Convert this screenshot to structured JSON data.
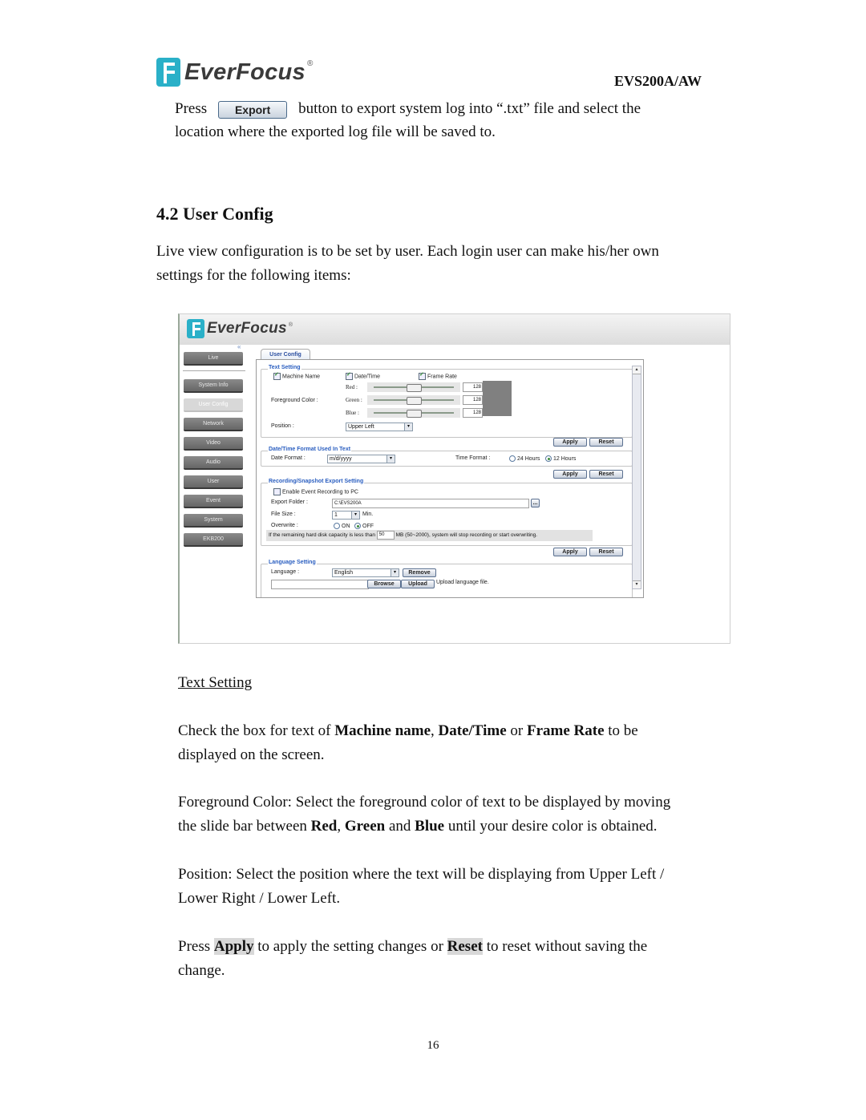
{
  "header": {
    "brand": "EverFocus",
    "brand_mark": "®",
    "model": "EVS200A/AW"
  },
  "intro": {
    "press": "Press",
    "export_button": "Export",
    "line1_rest": "button to export system log into “.txt” file and select the",
    "line2": "location where the exported log file will be saved to."
  },
  "section": {
    "title": "4.2 User Config",
    "desc_line1": "Live view configuration is to be set by user. Each login user can make his/her own",
    "desc_line2": "settings for the following items:"
  },
  "screenshot": {
    "brand": "EverFocus",
    "brand_mark": "®",
    "collapse_icon": "«",
    "nav": [
      {
        "label": "Live",
        "active": false
      },
      {
        "label": "System Info",
        "active": false
      },
      {
        "label": "User Config",
        "active": true
      },
      {
        "label": "Network",
        "active": false
      },
      {
        "label": "Video",
        "active": false
      },
      {
        "label": "Audio",
        "active": false
      },
      {
        "label": "User",
        "active": false
      },
      {
        "label": "Event",
        "active": false
      },
      {
        "label": "System",
        "active": false
      },
      {
        "label": "EKB200",
        "active": false
      }
    ],
    "tab": "User Config",
    "text_setting": {
      "legend": "Text Setting",
      "machine_name": "Machine Name",
      "machine_name_checked": true,
      "date_time": "Date/Time",
      "date_time_checked": true,
      "frame_rate": "Frame Rate",
      "frame_rate_checked": true,
      "foreground_label": "Foreground Color :",
      "red_label": "Red :",
      "green_label": "Green :",
      "blue_label": "Blue :",
      "red_value": "128",
      "green_value": "128",
      "blue_value": "128",
      "swatch_color": "#808080",
      "position_label": "Position :",
      "position_value": "Upper Left"
    },
    "date_time_format": {
      "legend": "Date/Time Format Used In Text",
      "date_format_label": "Date Format :",
      "date_format_value": "m/d/yyyy",
      "time_format_label": "Time Format :",
      "opt_24": "24 Hours",
      "opt_12": "12 Hours",
      "selected": "12 Hours"
    },
    "recording": {
      "legend": "Recording/Snapshot Export Setting",
      "enable_label": "Enable Event Recording to PC",
      "enable_checked": false,
      "export_folder_label": "Export Folder :",
      "export_folder_value": "C:\\EVS200A",
      "browse_icon": "...",
      "file_size_label": "File Size :",
      "file_size_value": "1",
      "file_size_unit": "Min.",
      "overwrite_label": "Overwrite :",
      "opt_on": "ON",
      "opt_off": "OFF",
      "overwrite_selected": "OFF",
      "warn_pre": "If the remaining hard disk capacity is less than",
      "warn_value": "50",
      "warn_post": "MB (50~2000), system will stop recording or start overwriting."
    },
    "language": {
      "legend": "Language Setting",
      "language_label": "Language :",
      "language_value": "English",
      "remove": "Remove",
      "browse": "Browse",
      "upload": "Upload",
      "upload_hint": "Upload language file."
    },
    "apply": "Apply",
    "reset": "Reset"
  },
  "body": {
    "subheading": "Text Setting",
    "p1": {
      "a": "Check the box for text of ",
      "b1": "Machine name",
      "c": ", ",
      "b2": "Date/Time",
      "d": " or ",
      "b3": "Frame Rate",
      "e": " to be",
      "line2": "displayed on the screen."
    },
    "p2": {
      "line1": "Foreground Color: Select the foreground color of text to be displayed by moving",
      "a": "the slide bar between ",
      "b1": "Red",
      "c": ", ",
      "b2": "Green",
      "d": " and ",
      "b3": "Blue",
      "e": " until your desire color is obtained."
    },
    "p3": {
      "line1": "Position: Select the position where the text will be displaying from Upper Left /",
      "line2": "Lower Right / Lower Left."
    },
    "p4": {
      "a": "Press ",
      "b1": "Apply",
      "c": " to apply the setting changes or ",
      "b2": "Reset",
      "d": " to reset without saving the",
      "line2": "change."
    }
  },
  "footer": {
    "page_number": "16"
  }
}
